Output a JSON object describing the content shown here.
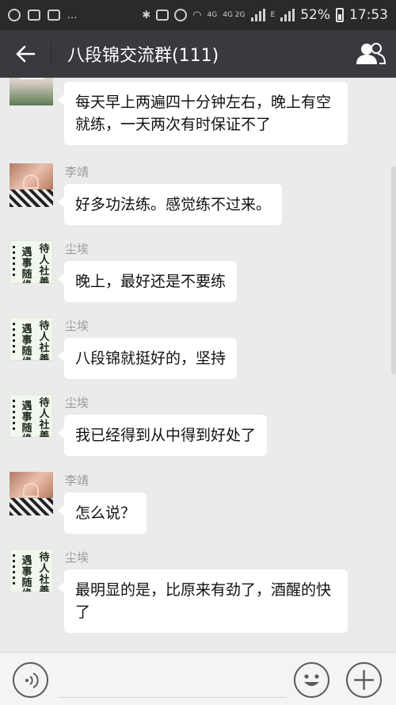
{
  "status_bar": {
    "more": "...",
    "network_4g": "4G",
    "network_2g": "4G 2G",
    "network_e": "E",
    "battery_percent": "52%",
    "time": "17:53"
  },
  "header": {
    "title": "八段锦交流群(111)"
  },
  "messages": [
    {
      "sender": "",
      "text": "每天早上两遍四十分钟左右，晚上有空就练，一天两次有时保证不了",
      "avatar": "cake-avatar"
    },
    {
      "sender": "李靖",
      "text": "好多功法练。感觉练不过来。",
      "avatar": "photo-avatar"
    },
    {
      "sender": "尘埃",
      "text": "晚上，最好还是不要练",
      "avatar": "calligraphy-avatar"
    },
    {
      "sender": "尘埃",
      "text": "八段锦就挺好的，坚持",
      "avatar": "calligraphy-avatar"
    },
    {
      "sender": "尘埃",
      "text": "我已经得到从中得到好处了",
      "avatar": "calligraphy-avatar"
    },
    {
      "sender": "李靖",
      "text": "怎么说？",
      "avatar": "photo-avatar"
    },
    {
      "sender": "尘埃",
      "text": "最明显的是，比原来有劲了，酒醒的快了",
      "avatar": "calligraphy-avatar"
    }
  ],
  "calligraphy": {
    "line1": "待人社善",
    "line2": "遇事随缘"
  },
  "colors": {
    "header_bg": "#393a3f",
    "status_bg": "#2a2a2a",
    "chat_bg": "#ebebeb",
    "bubble_bg": "#ffffff"
  }
}
